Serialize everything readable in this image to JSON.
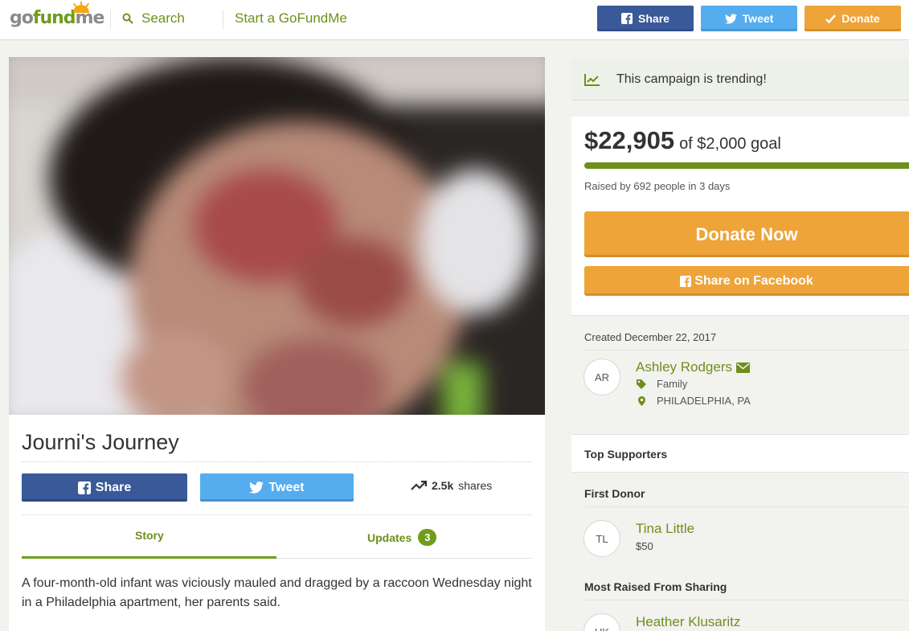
{
  "header": {
    "logo": {
      "part1": "go",
      "part2": "fund",
      "part3": "me"
    },
    "search_label": "Search",
    "start_label": "Start a GoFundMe",
    "share_label": "Share",
    "tweet_label": "Tweet",
    "donate_label": "Donate"
  },
  "campaign": {
    "title": "Journi's Journey",
    "share_label": "Share",
    "tweet_label": "Tweet",
    "shares_count": "2.5k",
    "shares_suffix": "shares",
    "tabs": {
      "story": "Story",
      "updates": "Updates",
      "updates_count": "3"
    },
    "story_text": "A four-month-old infant was viciously mauled and dragged by a raccoon Wednesday night in a Philadelphia apartment, her parents said."
  },
  "sidebar": {
    "trending_text": "This campaign is trending!",
    "raised_amount": "$22,905",
    "goal_text": "of $2,000 goal",
    "progress_fraction": 1.0,
    "raised_by": "Raised by 692 people in 3 days",
    "donate_now_label": "Donate Now",
    "share_facebook_label": "Share on Facebook",
    "created": "Created December 22, 2017",
    "organizer": {
      "initials": "AR",
      "name": "Ashley Rodgers",
      "category": "Family",
      "location": "PHILADELPHIA, PA"
    },
    "top_supporters_label": "Top Supporters",
    "first_donor_label": "First Donor",
    "first_donor": {
      "initials": "TL",
      "name": "Tina Little",
      "amount": "$50"
    },
    "most_sharing_label": "Most Raised From Sharing",
    "most_sharing": {
      "initials": "HK",
      "name": "Heather Klusaritz"
    }
  },
  "colors": {
    "brand_green": "#6f9d1a",
    "facebook_blue": "#3a5998",
    "twitter_blue": "#55acee",
    "donate_orange": "#eea438"
  },
  "icons": [
    "search-icon",
    "facebook-icon",
    "twitter-icon",
    "check-icon",
    "trending-icon",
    "envelope-icon",
    "tag-icon",
    "map-pin-icon"
  ]
}
